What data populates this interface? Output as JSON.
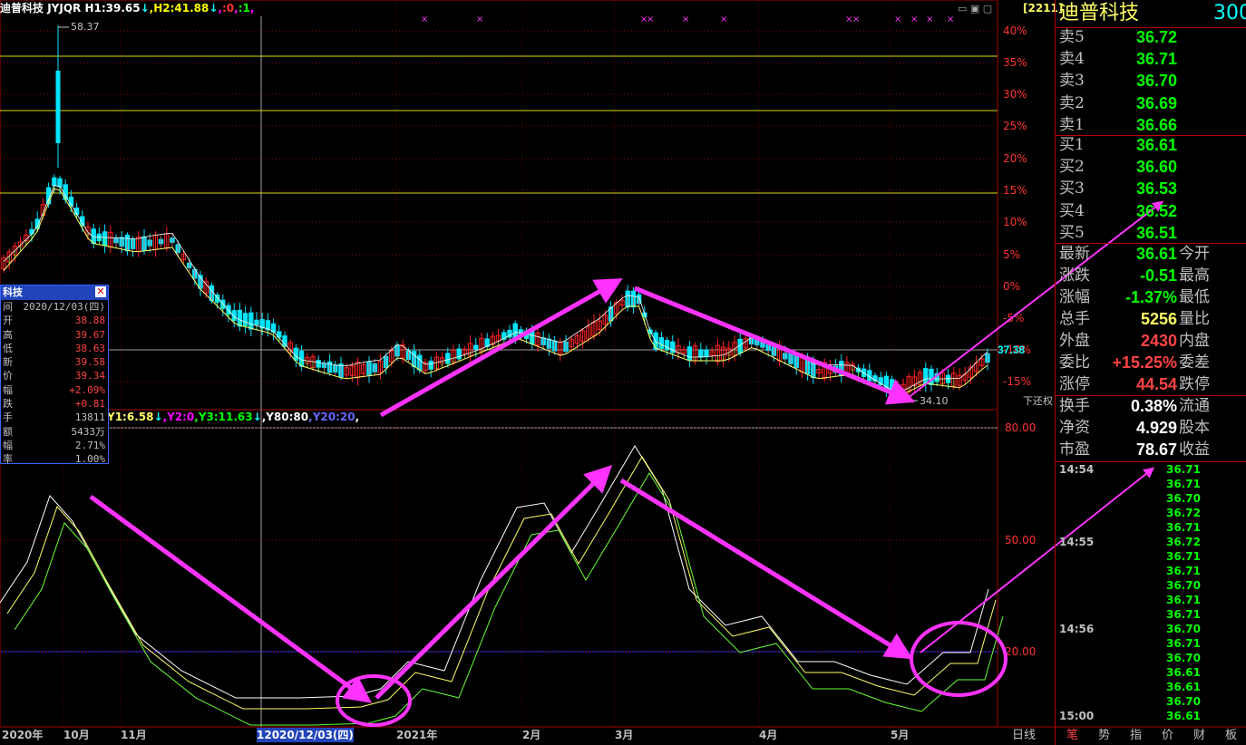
{
  "header": {
    "stock_name": "迪普科技",
    "indicator_line": [
      {
        "text": "JYJQR",
        "color": "#ffffff"
      },
      {
        "text": " H1:39.65",
        "color": "#ffffff"
      },
      {
        "text": "↓",
        "color": "#00ffff"
      },
      {
        "text": ",H2:41.88",
        "color": "#ffff00"
      },
      {
        "text": "↓",
        "color": "#00ffff"
      },
      {
        "text": ",",
        "color": "#ff00ff"
      },
      {
        "text": ":0",
        "color": "#ff3333"
      },
      {
        "text": ",",
        "color": "#ff00ff"
      },
      {
        "text": ":1",
        "color": "#00ff00"
      },
      {
        "text": ",",
        "color": "#ff00ff"
      }
    ]
  },
  "sub_indicator_line": [
    {
      "text": "Y1:6.58",
      "color": "#ffff66"
    },
    {
      "text": "↓",
      "color": "#00ffff"
    },
    {
      "text": ",Y2:0",
      "color": "#ff00ff"
    },
    {
      "text": ",Y3:11.63",
      "color": "#00ff00"
    },
    {
      "text": "↓",
      "color": "#00ffff"
    },
    {
      "text": ",Y80:80",
      "color": "#ffffff"
    },
    {
      "text": ",Y20:20",
      "color": "#6666ff"
    },
    {
      "text": ",",
      "color": "#ffffff"
    }
  ],
  "chart_data": {
    "type": "candlestick",
    "price_axis_percent_labels": [
      "40%",
      "35%",
      "30%",
      "25%",
      "20%",
      "15%",
      "10%",
      "5%",
      "0%",
      "-5%",
      "-10%",
      "-15%"
    ],
    "horizontal_ref_lines": [
      35.7,
      27.3,
      14.6,
      37.38
    ],
    "current_price_label": "37.38",
    "annotation_high": "58.37",
    "annotation_low": "34.10",
    "restore_label": "下还权",
    "sub_axis_labels": [
      "80.00",
      "50.00",
      "20.00"
    ],
    "x_labels": [
      "2020年",
      "10月",
      "11月",
      "12020/12/03(四)",
      "2021年",
      "2月",
      "3月",
      "4月",
      "5月"
    ],
    "x_right_label": "日线",
    "kdj_ref": {
      "upper": 80,
      "lower": 20
    }
  },
  "infobox": {
    "title": "科技",
    "rows": [
      {
        "k": "间",
        "v": "2020/12/03(四)",
        "c": "#c0c0c0"
      },
      {
        "k": "开",
        "v": "38.88",
        "c": "#ff4444"
      },
      {
        "k": "高",
        "v": "39.67",
        "c": "#ff4444"
      },
      {
        "k": "低",
        "v": "38.63",
        "c": "#ff4444"
      },
      {
        "k": "新",
        "v": "39.58",
        "c": "#ff4444"
      },
      {
        "k": "价",
        "v": "39.34",
        "c": "#ff4444"
      },
      {
        "k": "幅",
        "v": "+2.09%",
        "c": "#ff4444"
      },
      {
        "k": "跌",
        "v": "+0.81",
        "c": "#ff4444"
      },
      {
        "k": "手",
        "v": "13811",
        "c": "#c0c0c0"
      },
      {
        "k": "额",
        "v": "5433万",
        "c": "#c0c0c0"
      },
      {
        "k": "幅",
        "v": "2.71%",
        "c": "#c0c0c0"
      },
      {
        "k": "率",
        "v": "1.00%",
        "c": "#c0c0c0"
      }
    ]
  },
  "panel": {
    "code_badge": "[2211]",
    "title": "迪普科技",
    "code": "300",
    "asks": [
      {
        "label": "卖5",
        "value": "36.72"
      },
      {
        "label": "卖4",
        "value": "36.71"
      },
      {
        "label": "卖3",
        "value": "36.70"
      },
      {
        "label": "卖2",
        "value": "36.69"
      },
      {
        "label": "卖1",
        "value": "36.66"
      }
    ],
    "bids": [
      {
        "label": "买1",
        "value": "36.61"
      },
      {
        "label": "买2",
        "value": "36.60"
      },
      {
        "label": "买3",
        "value": "36.53"
      },
      {
        "label": "买4",
        "value": "36.52"
      },
      {
        "label": "买5",
        "value": "36.51"
      }
    ],
    "stats": [
      {
        "label": "最新",
        "value": "36.61",
        "color": "#00ff00",
        "label2": "今开"
      },
      {
        "label": "涨跌",
        "value": "-0.51",
        "color": "#00ff00",
        "label2": "最高"
      },
      {
        "label": "涨幅",
        "value": "-1.37%",
        "color": "#00ff00",
        "label2": "最低"
      },
      {
        "label": "总手",
        "value": "5256",
        "color": "#ffff66",
        "label2": "量比"
      },
      {
        "label": "外盘",
        "value": "2430",
        "color": "#ff4444",
        "label2": "内盘"
      },
      {
        "label": "委比",
        "value": "+15.25%",
        "color": "#ff4444",
        "label2": "委差"
      },
      {
        "label": "涨停",
        "value": "44.54",
        "color": "#ff4444",
        "label2": "跌停"
      }
    ],
    "stats2": [
      {
        "label": "换手",
        "value": "0.38%",
        "label2": "流通"
      },
      {
        "label": "净资",
        "value": "4.929",
        "label2": "股本"
      },
      {
        "label": "市盈",
        "value": "78.67",
        "label2": "收益"
      }
    ],
    "ticks": [
      {
        "time": "14:54",
        "value": "36.71"
      },
      {
        "time": "",
        "value": "36.71"
      },
      {
        "time": "",
        "value": "36.70"
      },
      {
        "time": "",
        "value": "36.72"
      },
      {
        "time": "",
        "value": "36.71"
      },
      {
        "time": "14:55",
        "value": "36.72"
      },
      {
        "time": "",
        "value": "36.71"
      },
      {
        "time": "",
        "value": "36.71"
      },
      {
        "time": "",
        "value": "36.70"
      },
      {
        "time": "",
        "value": "36.71"
      },
      {
        "time": "",
        "value": "36.71"
      },
      {
        "time": "14:56",
        "value": "36.70"
      },
      {
        "time": "",
        "value": "36.71"
      },
      {
        "time": "",
        "value": "36.70"
      },
      {
        "time": "",
        "value": "36.61"
      },
      {
        "time": "",
        "value": "36.61"
      },
      {
        "time": "",
        "value": "36.70"
      },
      {
        "time": "15:00",
        "value": "36.61"
      }
    ],
    "bottom_tabs": [
      "笔",
      "势",
      "指",
      "价",
      "财",
      "板"
    ]
  },
  "colors": {
    "up": "#ff2020",
    "down": "#00e5ff",
    "accent": "#ff33ff",
    "grid_red": "#aa0000",
    "ma": "#ffff66"
  }
}
